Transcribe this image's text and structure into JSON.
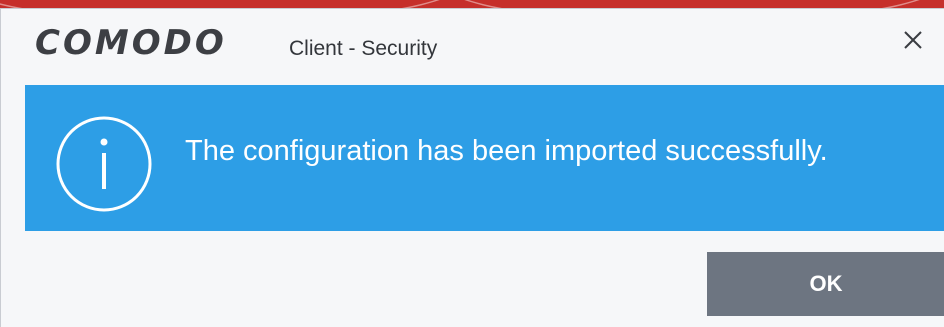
{
  "window": {
    "brand": "COMODO",
    "product": "Client - Security",
    "close_icon": "close-icon"
  },
  "dialog": {
    "icon": "info-icon",
    "message": "The configuration has been imported successfully.",
    "ok_label": "OK"
  },
  "colors": {
    "banner": "#2d9ee6",
    "button": "#6d7581",
    "background": "#f6f7f9",
    "brand_text": "#3d3f44",
    "accent_strip": "#c62f2b"
  }
}
